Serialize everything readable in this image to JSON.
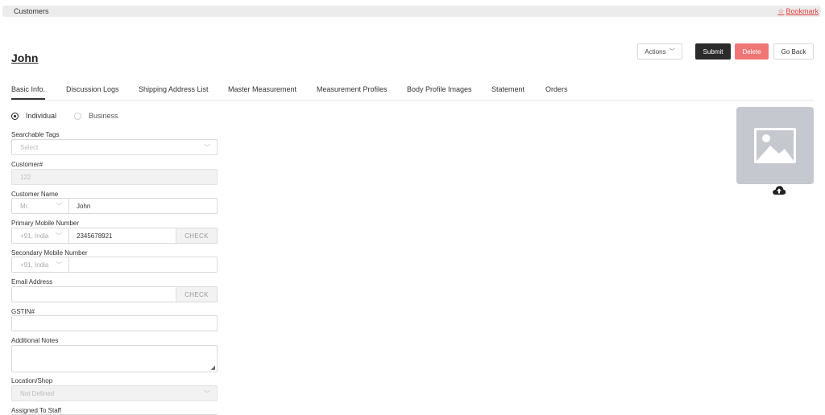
{
  "header": {
    "breadcrumb": "Customers",
    "bookmark": "Bookmark"
  },
  "page": {
    "title": "John"
  },
  "toolbar": {
    "actions": "Actions",
    "submit": "Submit",
    "delete": "Delete",
    "go_back": "Go Back"
  },
  "tabs": [
    "Basic Info.",
    "Discussion Logs",
    "Shipping Address List",
    "Master Measurement",
    "Measurement Profiles",
    "Body Profile Images",
    "Statement",
    "Orders"
  ],
  "customer_type": {
    "options": [
      "Individual",
      "Business"
    ],
    "selected": "Individual"
  },
  "form": {
    "searchable_tags": {
      "label": "Searchable Tags",
      "placeholder": "Select"
    },
    "customer_no": {
      "label": "Customer#",
      "value": "122"
    },
    "customer_name": {
      "label": "Customer Name",
      "salutation": "Mr.",
      "value": "John"
    },
    "primary_mobile": {
      "label": "Primary Mobile Number",
      "country": "+91, India",
      "value": "2345678921",
      "check": "CHECK"
    },
    "secondary_mobile": {
      "label": "Secondary Mobile Number",
      "country": "+91, India",
      "value": ""
    },
    "email": {
      "label": "Email Address",
      "value": "",
      "check": "CHECK"
    },
    "gstin": {
      "label": "GSTIN#",
      "value": ""
    },
    "notes": {
      "label": "Additional Notes",
      "value": ""
    },
    "location": {
      "label": "Location/Shop",
      "value": "Not Defined"
    },
    "assigned_staff": {
      "label": "Assigned To Staff"
    }
  },
  "profile_image": {
    "icon": "image-placeholder-icon",
    "upload_icon": "cloud-upload-icon"
  },
  "colors": {
    "accent": "#e0403f",
    "submit": "#2b2b2b",
    "delete": "#f07676",
    "placeholder_bg": "#c6c8cf"
  }
}
